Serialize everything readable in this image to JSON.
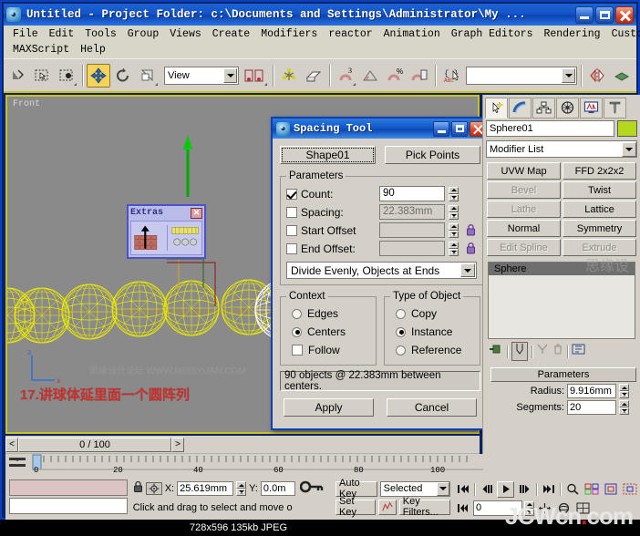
{
  "window": {
    "title": "Untitled            - Project Folder: c:\\Documents and Settings\\Administrator\\My ...",
    "logo": "max-logo-icon",
    "minimize": "minimize-icon",
    "maximize": "maximize-icon",
    "close": "close-icon"
  },
  "menubar": {
    "row1": [
      "File",
      "Edit",
      "Tools",
      "Group",
      "Views",
      "Create",
      "Modifiers",
      "reactor",
      "Animation",
      "Graph Editors",
      "Rendering",
      "Customize"
    ],
    "row2": [
      "MAXScript",
      "Help"
    ]
  },
  "toolbar": {
    "coordinate_system": "View",
    "name_search": "",
    "items": [
      "undo-icon",
      "select-object-icon",
      "select-by-name-icon",
      "select-region-icon",
      "select-and-move-icon",
      "select-and-rotate-icon",
      "select-and-scale-icon",
      "reference-coordinate-system",
      "use-pivot-center-icon",
      "mirror-icon",
      "align-icon",
      "array-icon",
      "snap-toggle-icon",
      "angle-snap-icon",
      "percent-snap-icon",
      "spinner-snap-icon",
      "named-selection-sets-icon",
      "mirror-tool-icon",
      "layer-manager-icon"
    ]
  },
  "viewport": {
    "label": "Front",
    "annotation": "17.讲球体延里面一个圆阵列",
    "watermark": "思缘设计论坛 WWW.MISSYUAN.COM",
    "axis_x": "x",
    "axis_z": "z",
    "extras_floater": {
      "title": "Extras",
      "close": "close-icon",
      "buttons": [
        "array-icon",
        "snapshot-icon",
        "spacing-tool-icon"
      ]
    }
  },
  "spacing_tool": {
    "title": "Spacing Tool",
    "logo": "max-logo-icon",
    "minimize": "minimize-icon",
    "maximize": "maximize-icon",
    "close": "close-icon",
    "pick_shape_label": "Shape01",
    "pick_points_label": "Pick Points",
    "parameters_legend": "Parameters",
    "rows": [
      {
        "label": "Count:",
        "checked": true,
        "value": "90",
        "enabled": true,
        "lock": false
      },
      {
        "label": "Spacing:",
        "checked": false,
        "value": "22.383mm",
        "enabled": false,
        "lock": false
      },
      {
        "label": "Start Offset",
        "checked": false,
        "value": "",
        "enabled": false,
        "lock": true
      },
      {
        "label": "End Offset:",
        "checked": false,
        "value": "",
        "enabled": false,
        "lock": true
      }
    ],
    "divide_mode": "Divide Evenly, Objects at Ends",
    "context_legend": "Context",
    "context_options": [
      {
        "label": "Edges",
        "selected": false,
        "type": "radio"
      },
      {
        "label": "Centers",
        "selected": true,
        "type": "radio"
      },
      {
        "label": "Follow",
        "selected": false,
        "type": "checkbox"
      }
    ],
    "type_legend": "Type of Object",
    "type_options": [
      {
        "label": "Copy",
        "selected": false
      },
      {
        "label": "Instance",
        "selected": true
      },
      {
        "label": "Reference",
        "selected": false
      }
    ],
    "info": "90 objects @ 22.383mm  between centers.",
    "apply_label": "Apply",
    "cancel_label": "Cancel"
  },
  "command_panel": {
    "tabs": [
      {
        "name": "create-tab",
        "icon": "arrow-star-icon",
        "selected": true
      },
      {
        "name": "modify-tab",
        "icon": "rainbow-arc-icon",
        "selected": false
      },
      {
        "name": "hierarchy-tab",
        "icon": "hierarchy-icon",
        "selected": false
      },
      {
        "name": "motion-tab",
        "icon": "wheel-icon",
        "selected": false
      },
      {
        "name": "display-tab",
        "icon": "monitor-icon",
        "selected": false
      },
      {
        "name": "utilities-tab",
        "icon": "hammer-icon",
        "selected": false
      }
    ],
    "object_name": "Sphere01",
    "object_color": "#b4d81e",
    "modifier_list": "Modifier List",
    "modifier_buttons": [
      {
        "label": "UVW Map",
        "enabled": true
      },
      {
        "label": "FFD 2x2x2",
        "enabled": true
      },
      {
        "label": "Bevel",
        "enabled": false
      },
      {
        "label": "Twist",
        "enabled": true
      },
      {
        "label": "Lathe",
        "enabled": false
      },
      {
        "label": "Lattice",
        "enabled": true
      },
      {
        "label": "Normal",
        "enabled": true
      },
      {
        "label": "Symmetry",
        "enabled": true
      },
      {
        "label": "Edit Spline",
        "enabled": false
      },
      {
        "label": "Extrude",
        "enabled": false
      }
    ],
    "stack_items": [
      "Sphere"
    ],
    "stack_tools": [
      "pin-stack-icon",
      "show-end-result-icon",
      "make-unique-icon",
      "remove-modifier-icon",
      "configure-sets-icon"
    ],
    "rollout_title": "Parameters",
    "params": [
      {
        "label": "Radius:",
        "value": "9.916mm"
      },
      {
        "label": "Segments:",
        "value": "20"
      }
    ]
  },
  "trackbar": {
    "prev_label": "<",
    "frame_display": "0 / 100",
    "next_label": ">",
    "ruler_ticks": [
      "0",
      "20",
      "40",
      "60",
      "80",
      "100"
    ]
  },
  "statusbar": {
    "lock_icon": "lock-icon",
    "selection_icon": "selection-lock-icon",
    "coords": [
      {
        "label": "X:",
        "value": "25.619mm"
      },
      {
        "label": "Y:",
        "value": "0.0m"
      }
    ],
    "key_icon": "key-icon",
    "prompt": "Click and drag to select and move o",
    "auto_key_label": "Auto Key",
    "set_key_label": "Set Key",
    "selected_label": "Selected",
    "key_filters_label": "Key Filters...",
    "current_frame": "0",
    "playback_icons": [
      "go-to-start-icon",
      "prev-frame-icon",
      "play-icon",
      "next-frame-icon",
      "go-to-end-icon"
    ],
    "nav_icons": [
      "zoom-icon",
      "zoom-all-icon",
      "zoom-extents-icon",
      "zoom-region-icon",
      "pan-icon",
      "arc-rotate-icon",
      "maximize-viewport-icon"
    ]
  },
  "footer": {
    "image_info": "728x596  135kb  JPEG",
    "site_name": "JCWcn",
    "site_dot": ".",
    "site_tld": "com"
  }
}
